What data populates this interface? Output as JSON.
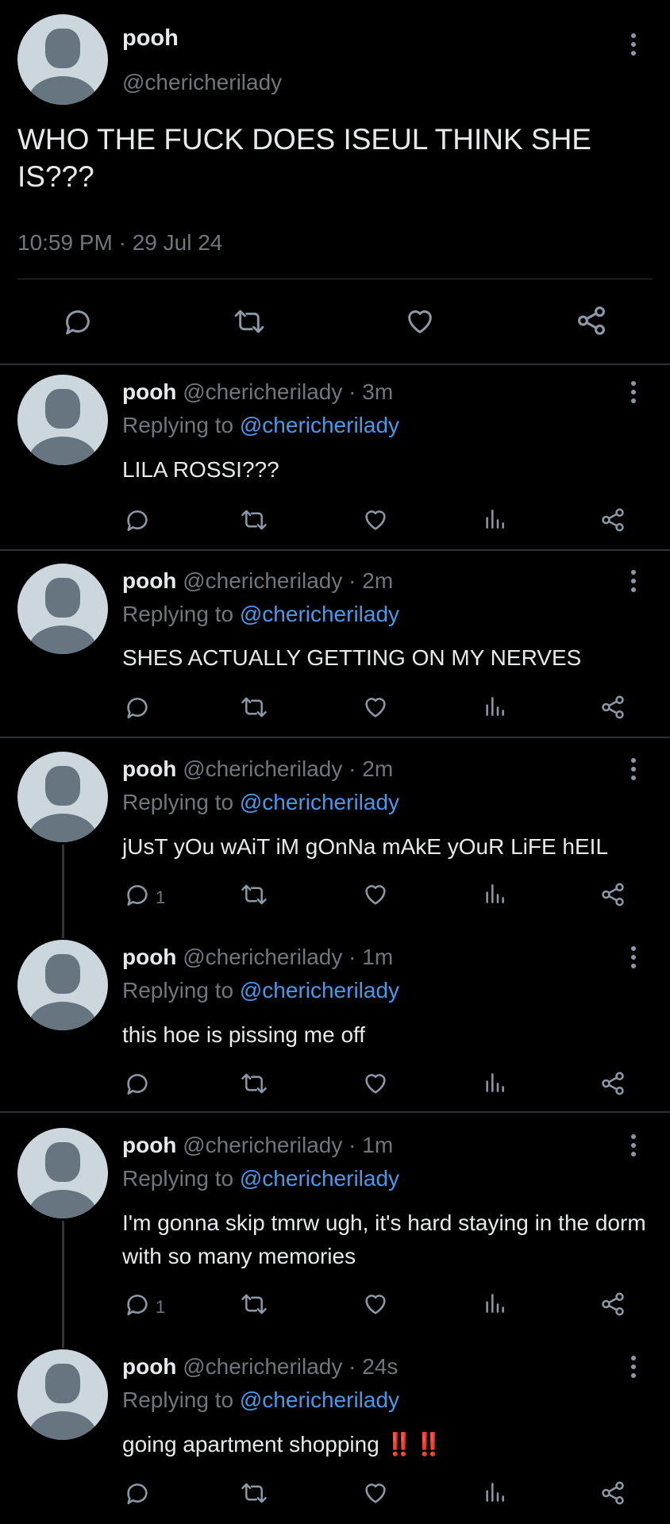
{
  "main_tweet": {
    "name": "pooh",
    "handle": "@chericherilady",
    "text": "WHO THE FUCK DOES ISEUL THINK SHE IS???",
    "timestamp": "10:59 PM · 29 Jul 24"
  },
  "replies": [
    {
      "name": "pooh",
      "handle_time": "@chericherilady · 3m",
      "replying_prefix": "Replying to ",
      "replying_to": "@chericherilady",
      "text": "LILA ROSSI???",
      "reply_count": ""
    },
    {
      "name": "pooh",
      "handle_time": "@chericherilady · 2m",
      "replying_prefix": "Replying to ",
      "replying_to": "@chericherilady",
      "text": "SHES ACTUALLY GETTING ON MY NERVES",
      "reply_count": ""
    },
    {
      "name": "pooh",
      "handle_time": "@chericherilady · 2m",
      "replying_prefix": "Replying to ",
      "replying_to": "@chericherilady",
      "text": "jUsT yOu wAiT iM gOnNa mAkE yOuR LiFE hEIL",
      "reply_count": "1"
    },
    {
      "name": "pooh",
      "handle_time": "@chericherilady · 1m",
      "replying_prefix": "Replying to ",
      "replying_to": "@chericherilady",
      "text": "this hoe is pissing me off",
      "reply_count": ""
    },
    {
      "name": "pooh",
      "handle_time": "@chericherilady · 1m",
      "replying_prefix": "Replying to ",
      "replying_to": "@chericherilady",
      "text": "I'm gonna skip tmrw ugh, it's hard staying in the dorm with so many memories",
      "reply_count": "1"
    },
    {
      "name": "pooh",
      "handle_time": "@chericherilady · 24s",
      "replying_prefix": "Replying to ",
      "replying_to": "@chericherilady",
      "text": "going apartment shopping",
      "text_suffix": "‼️‼️",
      "reply_count": ""
    }
  ],
  "icons": {
    "reply": "reply-icon",
    "retweet": "retweet-icon",
    "like": "heart-icon",
    "views": "views-icon",
    "share": "share-icon",
    "menu": "more-vertical-icon"
  },
  "colors": {
    "background": "#000000",
    "text": "#e7e9ea",
    "muted": "#71767b",
    "mention": "#4a99e9",
    "divider": "#2f3336"
  }
}
